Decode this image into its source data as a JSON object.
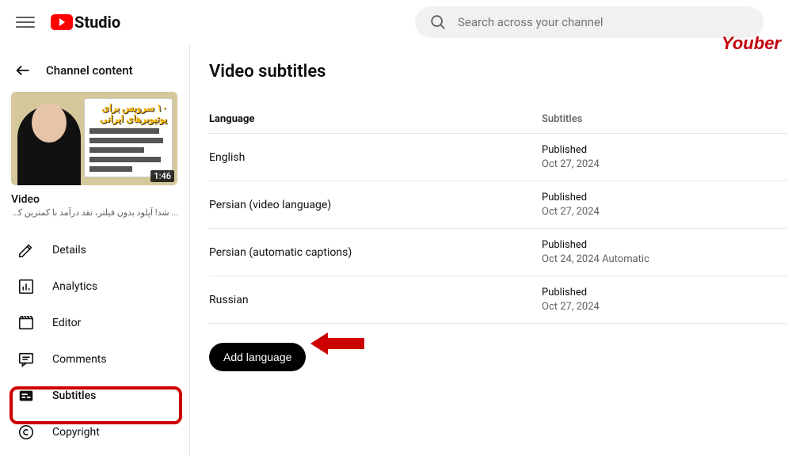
{
  "header": {
    "logo_text": "Studio",
    "search_placeholder": "Search across your channel",
    "watermark": "Youber"
  },
  "sidebar": {
    "back_label": "Channel content",
    "thumb_duration": "1:46",
    "thumb_title_fa": "۱۰ سرویس برای یوتیوبرهای ایرانی",
    "video_label": "Video",
    "video_desc": "... شد! آپلود بدون فیلتر، نقد درآمد با کمترین کارمزد",
    "nav": [
      {
        "icon": "pencil",
        "label": "Details"
      },
      {
        "icon": "analytics",
        "label": "Analytics"
      },
      {
        "icon": "editor",
        "label": "Editor"
      },
      {
        "icon": "comments",
        "label": "Comments"
      },
      {
        "icon": "subtitles",
        "label": "Subtitles"
      },
      {
        "icon": "copyright",
        "label": "Copyright"
      }
    ],
    "active_index": 4
  },
  "main": {
    "title": "Video subtitles",
    "columns": {
      "language": "Language",
      "subtitles": "Subtitles"
    },
    "rows": [
      {
        "language": "English",
        "status": "Published",
        "date": "Oct 27, 2024"
      },
      {
        "language": "Persian (video language)",
        "status": "Published",
        "date": "Oct 27, 2024"
      },
      {
        "language": "Persian (automatic captions)",
        "status": "Published",
        "date": "Oct 24, 2024 Automatic"
      },
      {
        "language": "Russian",
        "status": "Published",
        "date": "Oct 27, 2024"
      }
    ],
    "add_button": "Add language"
  }
}
